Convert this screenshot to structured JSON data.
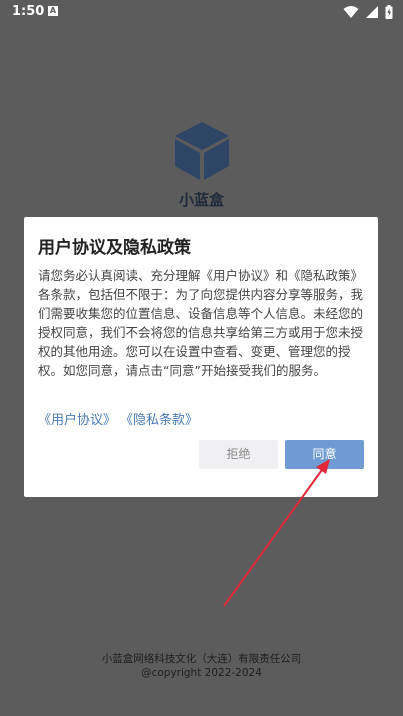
{
  "status": {
    "time": "1:50",
    "notification_letter": "A"
  },
  "app": {
    "name": "小蓝盒"
  },
  "dialog": {
    "title": "用户协议及隐私政策",
    "body": "请您务必认真阅读、充分理解《用户协议》和《隐私政策》各条款，包括但不限于：为了向您提供内容分享等服务，我们需要收集您的位置信息、设备信息等个人信息。未经您的授权同意，我们不会将您的信息共享给第三方或用于您未授权的其他用途。您可以在设置中查看、变更、管理您的授权。如您同意，请点击“同意”开始接受我们的服务。",
    "link_user_agreement": "《用户协议》",
    "link_privacy": "《隐私条款》",
    "reject_label": "拒绝",
    "agree_label": "同意"
  },
  "footer": {
    "company": "小蓝盒网络科技文化（大连）有限责任公司",
    "copyright": "@copyright 2022-2024"
  },
  "colors": {
    "overlay": "#5c5c5c",
    "agree_button": "#6f9bd2",
    "link": "#4a7ab5",
    "arrow": "#e0283a"
  }
}
